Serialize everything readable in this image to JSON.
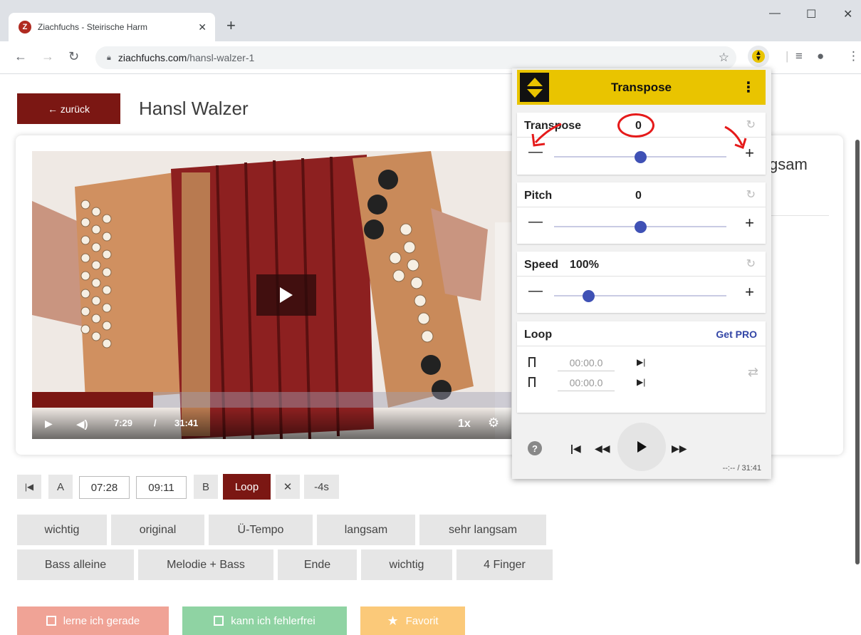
{
  "browser": {
    "tab_title": "Ziachfuchs - Steirische Harm",
    "favicon_letter": "Z",
    "url_host": "ziachfuchs.com",
    "url_path": "/hansl-walzer-1"
  },
  "page": {
    "back_label": "← zurück",
    "title": "Hansl Walzer",
    "side_text": "gsam"
  },
  "video": {
    "current_time": "7:29",
    "separator": "/",
    "duration": "31:41",
    "speed": "1x",
    "progress": 0.252
  },
  "ab": {
    "a_label": "A",
    "a_time": "07:28",
    "b_time": "09:11",
    "b_label": "B",
    "loop_label": "Loop",
    "close_label": "✕",
    "back_label": "-4s"
  },
  "chapters_row1": [
    "wichtig",
    "original",
    "Ü-Tempo",
    "langsam",
    "sehr langsam"
  ],
  "chapters_row2": [
    "Bass alleine",
    "Melodie + Bass",
    "Ende",
    "wichtig",
    "4 Finger"
  ],
  "status": {
    "learning": "lerne ich gerade",
    "mastered": "kann ich fehlerfrei",
    "favorite": "Favorit"
  },
  "popup": {
    "title": "Transpose",
    "transpose_label": "Transpose",
    "transpose_value": "0",
    "pitch_label": "Pitch",
    "pitch_value": "0",
    "speed_label": "Speed",
    "speed_value": "100%",
    "loop_label": "Loop",
    "get_pro": "Get PRO",
    "loop_start": "00:00.0",
    "loop_end": "00:00.0",
    "time_display": "--:-- / 31:41",
    "transpose_level": 0.5,
    "pitch_level": 0.5,
    "speed_level": 0.2
  },
  "colors": {
    "brand_red": "#7b1713",
    "ext_yellow": "#e9c400",
    "slider_blue": "#3f51b5",
    "learning": "#f0a396",
    "mastered": "#8fd3a3",
    "favorite": "#fbc979"
  }
}
